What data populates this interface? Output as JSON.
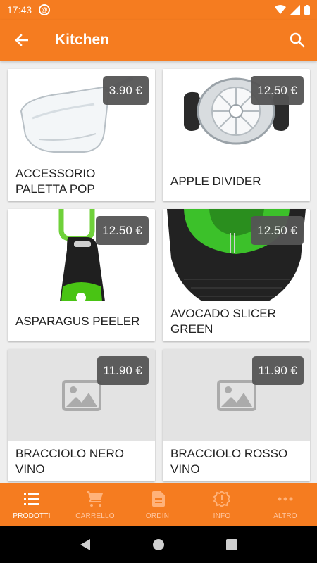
{
  "status_bar": {
    "time": "17:43"
  },
  "app_bar": {
    "title": "Kitchen"
  },
  "products": [
    {
      "name": "ACCESSORIO PALETTA POP",
      "price": "3.90 €",
      "image": "scoop"
    },
    {
      "name": "APPLE DIVIDER",
      "price": "12.50 €",
      "image": "apple-divider"
    },
    {
      "name": "ASPARAGUS PEELER",
      "price": "12.50 €",
      "image": "peeler"
    },
    {
      "name": "AVOCADO SLICER GREEN",
      "price": "12.50 €",
      "image": "avocado-slicer"
    },
    {
      "name": "BRACCIOLO NERO VINO",
      "price": "11.90 €",
      "image": "placeholder"
    },
    {
      "name": "BRACCIOLO ROSSO VINO",
      "price": "11.90 €",
      "image": "placeholder"
    }
  ],
  "bottom_nav": [
    {
      "label": "PRODOTTI",
      "icon": "list-icon",
      "active": true
    },
    {
      "label": "CARRELLO",
      "icon": "cart-icon",
      "active": false
    },
    {
      "label": "ORDINI",
      "icon": "document-icon",
      "active": false
    },
    {
      "label": "INFO",
      "icon": "alert-badge-icon",
      "active": false
    },
    {
      "label": "ALTRO",
      "icon": "more-icon",
      "active": false
    }
  ],
  "colors": {
    "primary": "#f57c20",
    "price_badge": "#555555",
    "placeholder": "#e3e3e3",
    "inactive_nav": "#ffc6a0"
  }
}
